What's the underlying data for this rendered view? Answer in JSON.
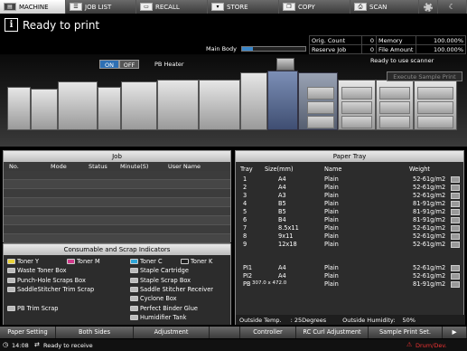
{
  "tabs": [
    {
      "label": "MACHINE",
      "icon": "printer-icon",
      "active": true
    },
    {
      "label": "JOB LIST",
      "icon": "list-icon"
    },
    {
      "label": "RECALL",
      "icon": "recall-icon"
    },
    {
      "label": "STORE",
      "icon": "store-icon"
    },
    {
      "label": "COPY",
      "icon": "copy-icon"
    },
    {
      "label": "SCAN",
      "icon": "scan-icon"
    }
  ],
  "header": {
    "status": "Ready to print",
    "main_body_label": "Main Body",
    "main_body_level": 0.17,
    "orig_count_label": "Orig. Count",
    "orig_count": "0",
    "memory_label": "Memory",
    "memory": "100.000%",
    "reserve_job_label": "Reserve Job",
    "reserve_job": "0",
    "file_amount_label": "File Amount",
    "file_amount": "100.000%",
    "scanner_status": "Ready to use scanner"
  },
  "machine": {
    "on_label": "ON",
    "off_label": "OFF",
    "pb_heater_label": "PB Heater",
    "execute_sample_label": "Execute Sample Print"
  },
  "job_panel": {
    "title": "Job",
    "columns": [
      "No.",
      "Mode",
      "Status",
      "Minute(S)",
      "User Name"
    ]
  },
  "consumables": {
    "title": "Consumable and Scrap Indicators",
    "items": [
      {
        "label": "Toner Y",
        "icon": "toner-y-icon",
        "color": "#e8d23a"
      },
      {
        "label": "Toner M",
        "icon": "toner-m-icon",
        "color": "#d03a8a"
      },
      {
        "label": "Toner C",
        "icon": "toner-c-icon",
        "color": "#2fa6d8"
      },
      {
        "label": "Toner K",
        "icon": "toner-k-icon",
        "color": "#222222"
      },
      {
        "label": "Waste Toner Box",
        "icon": "waste-toner-icon"
      },
      {
        "label": "Staple Cartridge",
        "icon": "staple-cartridge-icon"
      },
      {
        "label": "Punch-Hole Scraps Box",
        "icon": "punch-scraps-icon"
      },
      {
        "label": "Staple Scrap Box",
        "icon": "staple-scrap-icon"
      },
      {
        "label": "SaddleStitcher Trim Scrap",
        "icon": "saddle-trim-icon"
      },
      {
        "label": "Saddle Stitcher Receiver",
        "icon": "saddle-receiver-icon"
      },
      {
        "label": "Cyclone Box",
        "icon": "cyclone-box-icon"
      },
      {
        "label": "PB Trim Scrap",
        "icon": "pb-trim-icon"
      },
      {
        "label": "Perfect Binder Glue",
        "icon": "binder-glue-icon"
      },
      {
        "label": "Humidifier Tank",
        "icon": "humidifier-icon"
      }
    ]
  },
  "tray_panel": {
    "title": "Paper Tray",
    "columns": [
      "Tray",
      "Size(mm)",
      "Name",
      "Weight"
    ],
    "rows": [
      {
        "tray": "1",
        "size": "A4",
        "name": "Plain",
        "weight": "52-61g/m2"
      },
      {
        "tray": "2",
        "size": "A4",
        "name": "Plain",
        "weight": "52-61g/m2"
      },
      {
        "tray": "3",
        "size": "A3",
        "name": "Plain",
        "weight": "52-61g/m2"
      },
      {
        "tray": "4",
        "size": "B5",
        "name": "Plain",
        "weight": "81-91g/m2"
      },
      {
        "tray": "5",
        "size": "B5",
        "name": "Plain",
        "weight": "81-91g/m2"
      },
      {
        "tray": "6",
        "size": "B4",
        "name": "Plain",
        "weight": "81-91g/m2"
      },
      {
        "tray": "7",
        "size": "8.5x11",
        "name": "Plain",
        "weight": "52-61g/m2"
      },
      {
        "tray": "8",
        "size": "9x11",
        "name": "Plain",
        "weight": "52-61g/m2"
      },
      {
        "tray": "9",
        "size": "12x18",
        "name": "Plain",
        "weight": "52-61g/m2"
      },
      {
        "tray": "PI1",
        "size": "A4",
        "name": "Plain",
        "weight": "52-61g/m2"
      },
      {
        "tray": "PI2",
        "size": "A4",
        "name": "Plain",
        "weight": "52-61g/m2"
      },
      {
        "tray": "PB",
        "size": "307.0 x 472.0",
        "name": "Plain",
        "weight": "81-91g/m2"
      }
    ],
    "outside_temp_label": "Outside Temp.",
    "outside_temp": ": 25Degrees",
    "outside_humidity_label": "Outside Humidity:",
    "outside_humidity": "50%"
  },
  "bottom_buttons": [
    "Paper Setting",
    "Both Sides",
    "Adjustment",
    "",
    "Controller",
    "RC Curl Adjustment",
    "Sample Print Set.",
    "▶"
  ],
  "status_bar": {
    "time": "14:08",
    "message": "Ready to receive",
    "drum_label": "Drum/Dev."
  }
}
